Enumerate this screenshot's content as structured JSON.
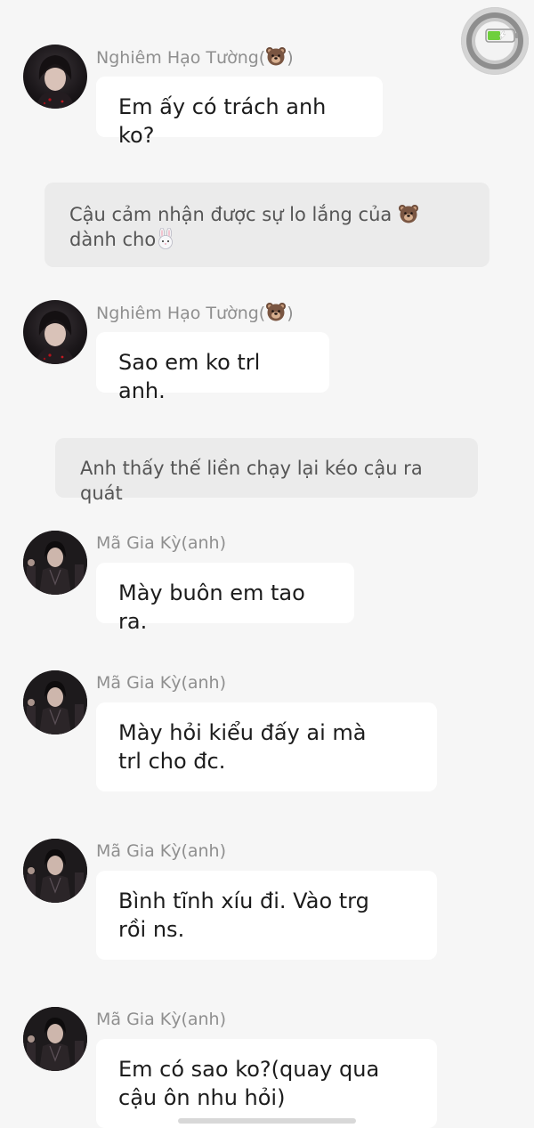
{
  "messages": [
    {
      "type": "chat",
      "avatar": "avatar-girl",
      "sender": "Nghiêm Hạo Tường(",
      "sender_emoji": "bear-emoji",
      "sender_suffix": ")",
      "text": "Em ấy có trách anh ko?"
    },
    {
      "type": "narration",
      "text": "Cậu cảm nhận được sự lo lắng của",
      "emoji": "bear-emoji",
      "text2": "dành cho",
      "emoji2": "rabbit-emoji"
    },
    {
      "type": "chat",
      "avatar": "avatar-girl",
      "sender": "Nghiêm Hạo Tường(",
      "sender_emoji": "bear-emoji",
      "sender_suffix": ")",
      "text": "Sao em ko trl anh."
    },
    {
      "type": "narration",
      "text": "Anh thấy thế liền chạy lại kéo cậu ra quát"
    },
    {
      "type": "chat",
      "avatar": "avatar-boy",
      "sender": "Mã Gia Kỳ(anh)",
      "text": "Mày buôn em tao ra."
    },
    {
      "type": "chat",
      "avatar": "avatar-boy",
      "sender": "Mã Gia Kỳ(anh)",
      "text": "Mày hỏi kiểu đấy ai mà trl cho đc."
    },
    {
      "type": "chat",
      "avatar": "avatar-boy",
      "sender": "Mã Gia Kỳ(anh)",
      "text": "Bình tĩnh xíu đi. Vào trg rồi ns."
    },
    {
      "type": "chat",
      "avatar": "avatar-boy",
      "sender": "Mã Gia Kỳ(anh)",
      "text": "Em có sao ko?(quay qua cậu ôn nhu hỏi)"
    }
  ],
  "colors": {
    "background": "#f6f6f6",
    "bubble": "#ffffff",
    "narration_bg": "#ebebeb",
    "name_text": "#8f8f8f",
    "battery_green": "#6fcf3d"
  }
}
